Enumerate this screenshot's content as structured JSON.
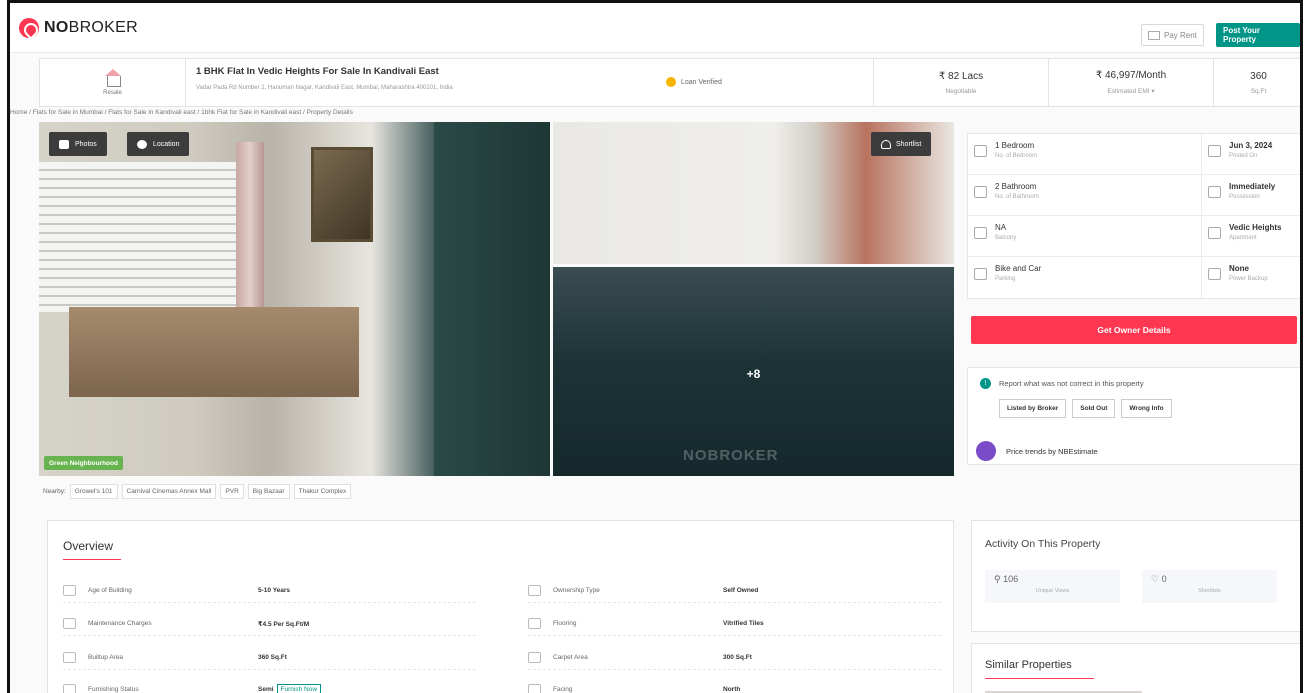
{
  "brand": {
    "logo": "NOBROKER",
    "logo_bold": "NO",
    "logo_thin": "BROKER",
    "accent": "#fd3752",
    "teal": "#009587"
  },
  "topbar": {
    "pay_rent": "Pay Rent",
    "post_property": "Post Your Property"
  },
  "header": {
    "type": "Resale",
    "title": "1 BHK Flat In Vedic Heights For Sale In Kandivali East",
    "address": "Vadar Pada Rd Number 2, Hanuman Nagar, Kandivali East, Mumbai, Maharashtra 400101, India",
    "loan": "Loan Verified",
    "price": "₹ 82 Lacs",
    "price_sub": "Negotiable",
    "emi": "₹ 46,997/Month",
    "emi_sub": "Estimated EMI ▾",
    "area": "360",
    "area_sub": "Sq.Ft"
  },
  "breadcrumb": "Home / Flats for Sale in Mumbai / Flats for Sale in Kandivali east / 1bhk Flat for Sale in Kandivali east / Property Details",
  "gallery": {
    "photos": "Photos",
    "location": "Location",
    "badge": "Green Neighbourhood",
    "shortlist": "Shortlist",
    "more": "+8",
    "watermark": "NOBROKER"
  },
  "nearby": {
    "label": "Nearby:",
    "items": [
      "Growel's 101",
      "Carnival Cinemas Annex Mall",
      "PVR",
      "Big Bazaar",
      "Thakur Complex"
    ]
  },
  "details": [
    {
      "v": "1 Bedroom",
      "s": "No. of Bedroom",
      "icon": "bed-icon"
    },
    {
      "v": "Jun 3, 2024",
      "s": "Posted On",
      "icon": "calendar-icon"
    },
    {
      "v": "2 Bathroom",
      "s": "No. of Bathroom",
      "icon": "bath-icon"
    },
    {
      "v": "Immediately",
      "s": "Possession",
      "icon": "key-icon"
    },
    {
      "v": "NA",
      "s": "Balcony",
      "icon": "balcony-icon"
    },
    {
      "v": "Vedic Heights",
      "s": "Apartment",
      "icon": "building-icon"
    },
    {
      "v": "Bike and Car",
      "s": "Parking",
      "icon": "car-icon"
    },
    {
      "v": "None",
      "s": "Power Backup",
      "icon": "battery-icon"
    }
  ],
  "owner_button": "Get Owner Details",
  "report": {
    "message": "Report what was not correct in this property",
    "buttons": [
      "Listed by Broker",
      "Sold Out",
      "Wrong Info"
    ],
    "trends": "Price trends by NBEstimate"
  },
  "overview": {
    "title": "Overview",
    "rows": [
      {
        "label": "Age of Building",
        "value": "5-10 Years",
        "icon": "building-age-icon"
      },
      {
        "label": "Ownership Type",
        "value": "Self Owned",
        "icon": "ownership-icon"
      },
      {
        "label": "Maintenance Charges",
        "value": "₹4.5 Per Sq.Ft/M",
        "icon": "maintenance-icon"
      },
      {
        "label": "Flooring",
        "value": "Vitrified Tiles",
        "icon": "flooring-icon"
      },
      {
        "label": "Builtup Area",
        "value": "360 Sq.Ft",
        "icon": "builtup-icon"
      },
      {
        "label": "Carpet Area",
        "value": "300 Sq.Ft",
        "icon": "carpet-icon"
      },
      {
        "label": "Furnishing Status",
        "value": "Semi",
        "tag": "Furnish Now",
        "icon": "sofa-icon"
      },
      {
        "label": "Facing",
        "value": "North",
        "icon": "compass-icon"
      }
    ]
  },
  "activity": {
    "title": "Activity On This Property",
    "views": "106",
    "views_label": "Unique Views",
    "shortlists": "0",
    "shortlists_label": "Shortlists"
  },
  "similar": {
    "title": "Similar Properties"
  }
}
